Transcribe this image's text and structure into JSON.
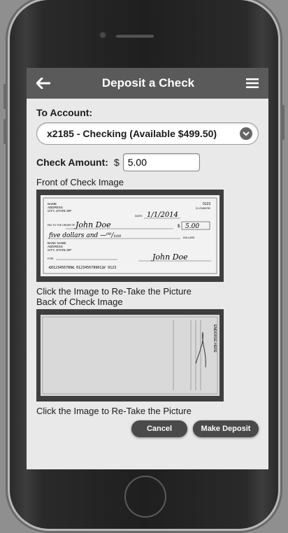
{
  "header": {
    "title": "Deposit a Check"
  },
  "form": {
    "to_account_label": "To Account:",
    "account_selected": "x2185 - Checking (Available $499.50)",
    "amount_label": "Check Amount:",
    "currency_symbol": "$",
    "amount_value": "5.00",
    "front_label": "Front of Check Image",
    "front_hint": "Click the Image to Re-Take the Picture",
    "back_label": "Back of Check Image",
    "back_hint": "Click the Image to Re-Take the Picture"
  },
  "actions": {
    "cancel_label": "Cancel",
    "deposit_label": "Make Deposit"
  },
  "check_front": {
    "name_line1": "NAME",
    "name_line2": "ADDRESS",
    "name_line3": "CITY, STATE ZIP",
    "check_number": "0123",
    "routing_fraction": "01-23456789",
    "date_label": "DATE",
    "date_value": "1/1/2014",
    "payee_label": "PAY TO THE ORDER OF",
    "payee_value": "John Doe",
    "amount_box": "5.00",
    "written_amount": "five dollars and —⁰⁰/₁₀₀",
    "dollars_label": "DOLLARS",
    "bank_line1": "BANK NAME",
    "bank_line2": "ADDRESS",
    "bank_line3": "CITY, STATE ZIP",
    "memo_label": "FOR",
    "signature": "John Doe",
    "micr": "⑆0123456789⑆ 0123456789012⑈ 0123"
  },
  "check_back": {
    "endorse_header": "ENDORSE HERE"
  },
  "icons": {
    "back": "arrow-left-icon",
    "menu": "hamburger-menu-icon",
    "dropdown": "chevron-down-icon"
  },
  "colors": {
    "topbar": "#5a5a5a",
    "screen_bg": "#e9e9e9",
    "button": "#4a4a4a"
  }
}
